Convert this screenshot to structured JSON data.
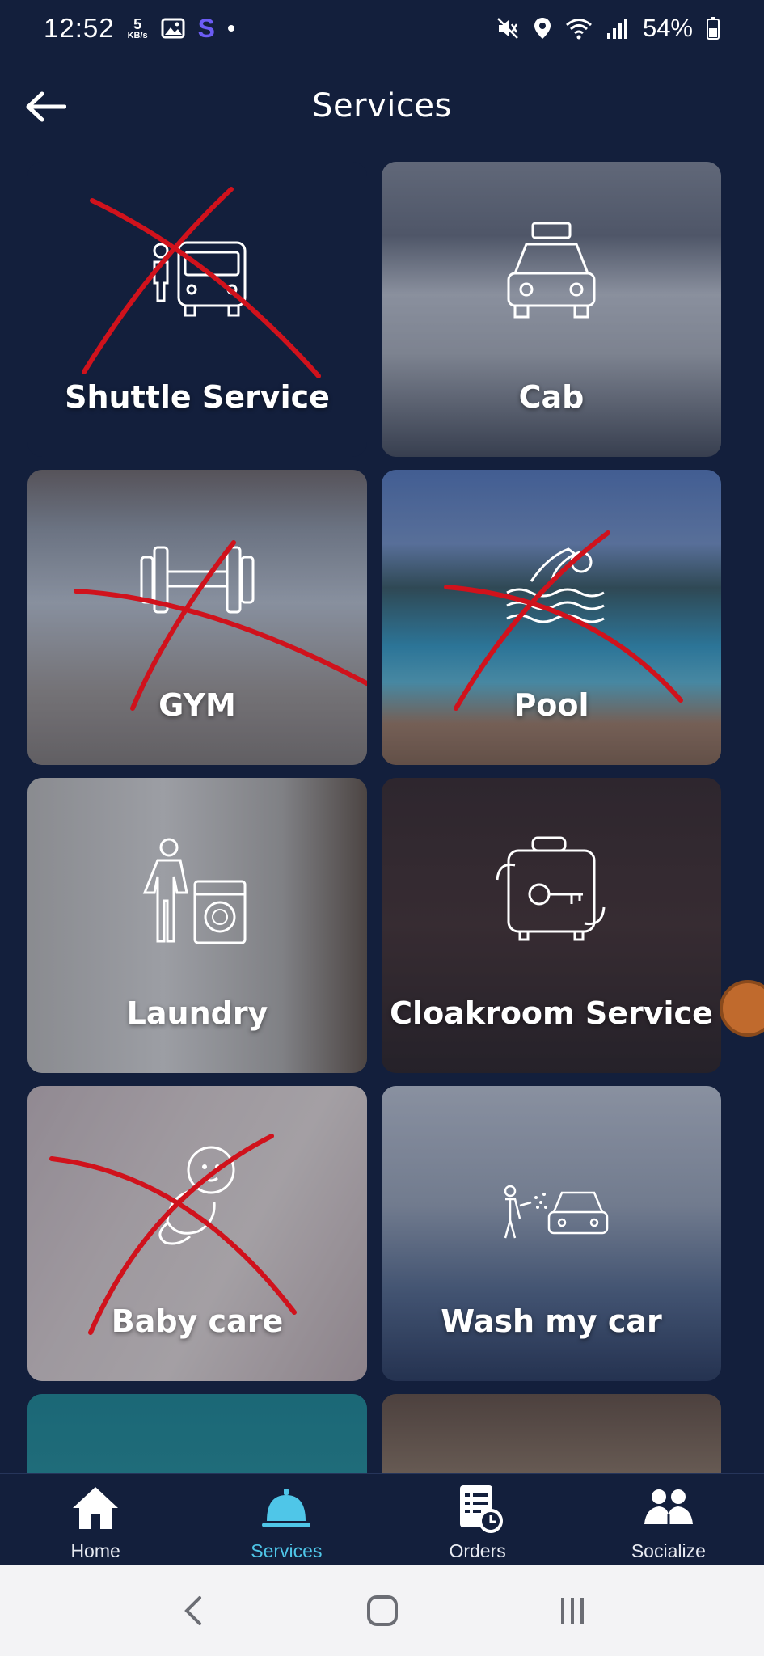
{
  "status_bar": {
    "time": "12:52",
    "speed_value": "5",
    "speed_unit": "KB/s",
    "app_letter": "S",
    "battery": "54%"
  },
  "header": {
    "title": "Services"
  },
  "tiles": [
    {
      "label": "Shuttle Service",
      "crossed": true
    },
    {
      "label": "Cab",
      "crossed": false
    },
    {
      "label": "GYM",
      "crossed": true
    },
    {
      "label": "Pool",
      "crossed": true
    },
    {
      "label": "Laundry",
      "crossed": false
    },
    {
      "label": "Cloakroom Service",
      "crossed": false
    },
    {
      "label": "Baby care",
      "crossed": true
    },
    {
      "label": "Wash my car",
      "crossed": false
    },
    {
      "label": "",
      "crossed": false
    },
    {
      "label": "",
      "crossed": false
    }
  ],
  "bottom_nav": {
    "items": [
      {
        "label": "Home",
        "icon": "home-icon",
        "active": false
      },
      {
        "label": "Services",
        "icon": "bell-icon",
        "active": true
      },
      {
        "label": "Orders",
        "icon": "orders-icon",
        "active": false
      },
      {
        "label": "Socialize",
        "icon": "people-icon",
        "active": false
      }
    ]
  },
  "colors": {
    "background": "#131f3c",
    "accent": "#4fc6e8",
    "cross": "#d0121c"
  }
}
